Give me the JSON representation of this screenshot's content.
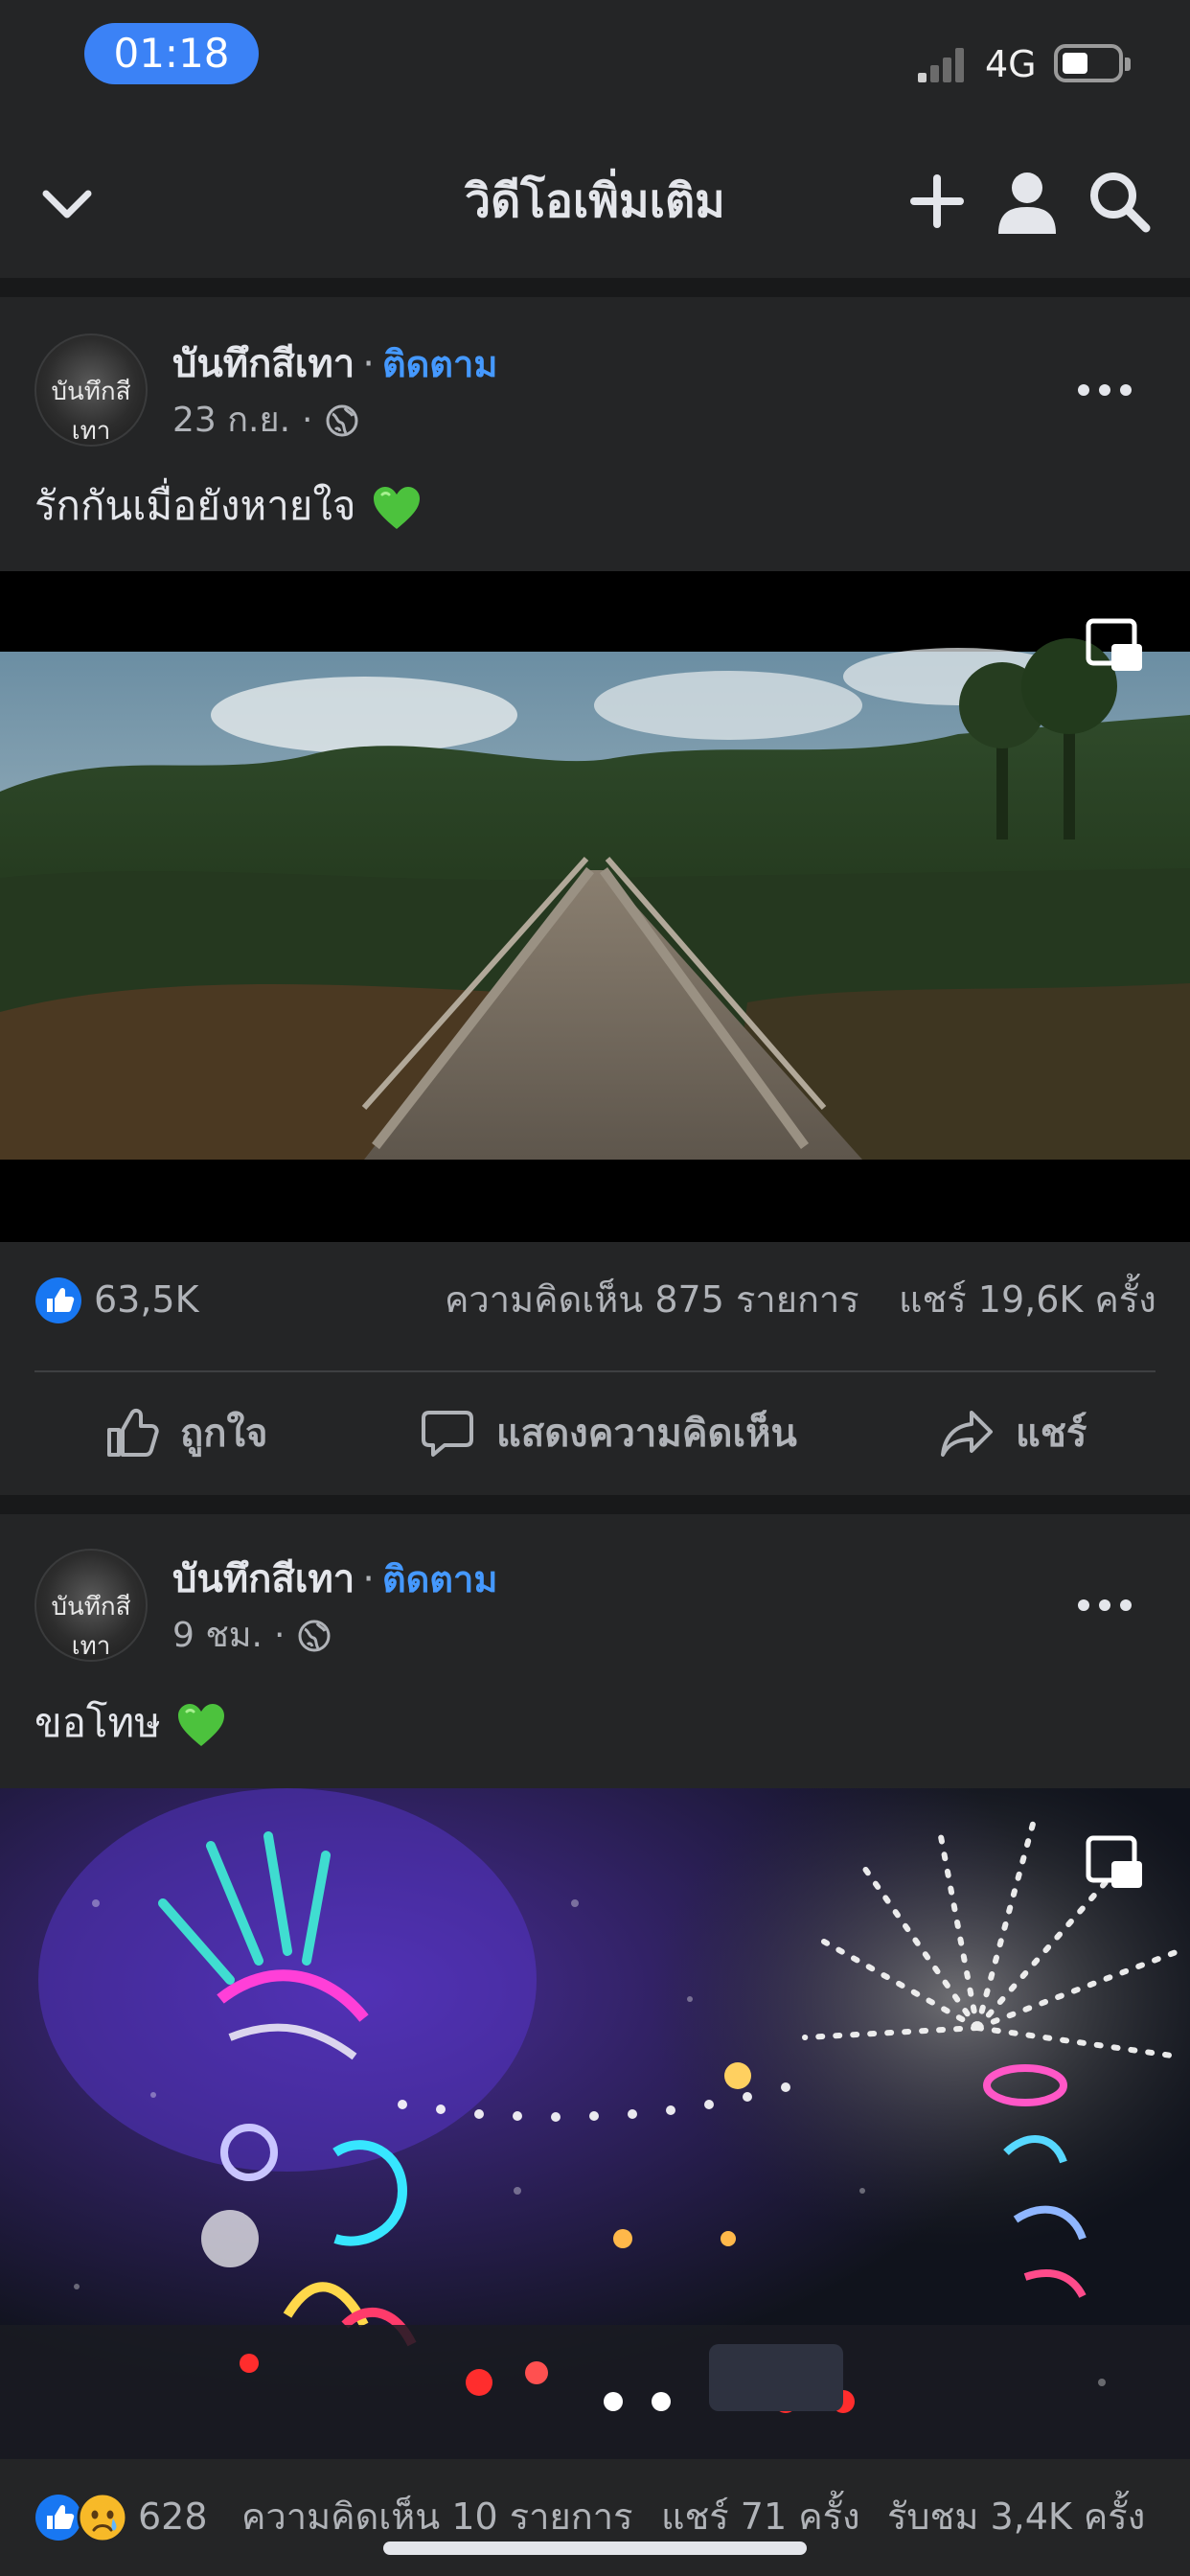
{
  "status_bar": {
    "time": "01:18",
    "network": "4G"
  },
  "header": {
    "title": "วิดีโอเพิ่มเติม",
    "icons": [
      "chevron-down-icon",
      "plus-icon",
      "profile-icon",
      "search-icon"
    ]
  },
  "posts": [
    {
      "page_name": "บันทึกสีเทา",
      "separator": "·",
      "follow_label": "ติดตาม",
      "timestamp": "23 ก.ย.",
      "meta_separator": "·",
      "avatar_text": "บันทึกสีเทา",
      "caption": "รักกันเมื่อยังหายใจ",
      "reactions_count": "63,5K",
      "comments": "ความคิดเห็น 875 รายการ",
      "shares": "แชร์ 19,6K ครั้ง",
      "actions": {
        "like": "ถูกใจ",
        "comment": "แสดงความคิดเห็น",
        "share": "แชร์"
      }
    },
    {
      "page_name": "บันทึกสีเทา",
      "separator": "·",
      "follow_label": "ติดตาม",
      "timestamp": "9 ชม.",
      "meta_separator": "·",
      "avatar_text": "บันทึกสีเทา",
      "caption": "ขอโทษ",
      "reactions_count": "628",
      "comments": "ความคิดเห็น 10 รายการ",
      "shares": "แชร์ 71 ครั้ง",
      "views": "รับชม 3,4K ครั้ง"
    }
  ],
  "colors": {
    "background": "#242526",
    "accent": "#4599ff",
    "like_blue": "#1877f2",
    "time_pill": "#3b82f6"
  }
}
